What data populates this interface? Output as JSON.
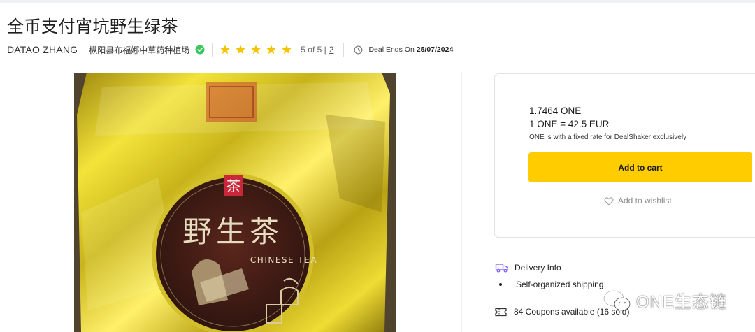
{
  "product": {
    "title": "全币支付宵坑野生绿茶",
    "seller": "DATAO ZHANG",
    "store": "枞阳县布福娜中草药种植场",
    "rating_text": "5 of 5 |",
    "reviews_count": "2",
    "stars": 5,
    "deal_label": "Deal Ends On",
    "deal_date": "25/07/2024"
  },
  "package": {
    "logo_char": "茶",
    "name": "野生茶",
    "subtitle": "CHINESE TEA"
  },
  "purchase": {
    "price": "1.7464 ONE",
    "rate": "1 ONE = 42.5 EUR",
    "note": "ONE is with a fixed rate for DealShaker exclusively",
    "add_to_cart": "Add to cart",
    "add_to_wishlist": "Add to wishlist"
  },
  "delivery": {
    "title": "Delivery Info",
    "shipping": "Self-organized shipping",
    "coupons": "84 Coupons available (16 sold)"
  },
  "watermark": {
    "text": "ONE生态链"
  },
  "colors": {
    "accent": "#ffcc00",
    "star": "#f5c400",
    "verified": "#3cc65f",
    "delivery_icon": "#7b5cff"
  },
  "icons": [
    "verified-check-icon",
    "star-icon",
    "clock-icon",
    "heart-icon",
    "delivery-truck-icon",
    "coupon-ticket-icon",
    "wechat-icon"
  ]
}
